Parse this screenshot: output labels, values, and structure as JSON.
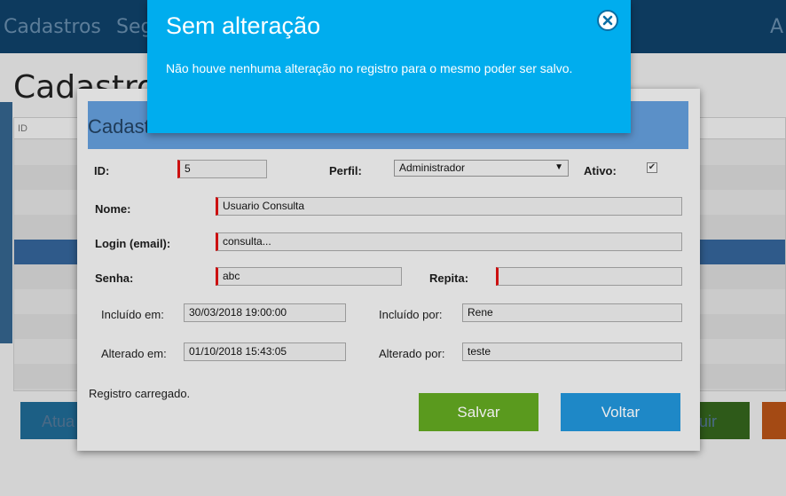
{
  "nav": {
    "items": [
      "Cadastros",
      "Seg",
      "A"
    ]
  },
  "background": {
    "page_title": "Cadastro",
    "table_header_id": "ID",
    "update_button": "Atua",
    "right_button": "uir"
  },
  "form": {
    "header_title": "Cadastro de Usuários",
    "id_label": "ID:",
    "id_value": "5",
    "perfil_label": "Perfil:",
    "perfil_selected": "Administrador",
    "ativo_label": "Ativo:",
    "ativo_checked": true,
    "nome_label": "Nome:",
    "nome_value": "Usuario Consulta",
    "login_label": "Login (email):",
    "login_value": "consulta...",
    "senha_label": "Senha:",
    "senha_value": "abc",
    "repita_label": "Repita:",
    "repita_value": "",
    "incluido_em_label": "Incluído em:",
    "incluido_em_value": "30/03/2018 19:00:00",
    "incluido_por_label": "Incluído por:",
    "incluido_por_value": "Rene",
    "alterado_em_label": "Alterado em:",
    "alterado_em_value": "01/10/2018 15:43:05",
    "alterado_por_label": "Alterado por:",
    "alterado_por_value": "teste",
    "status_text": "Registro carregado.",
    "save_label": "Salvar",
    "back_label": "Voltar"
  },
  "alert": {
    "title": "Sem alteração",
    "message": "Não houve nenhuma alteração no registro para o mesmo poder ser salvo.",
    "close_icon": "close-circle-icon"
  },
  "colors": {
    "alert_bg": "#00adee",
    "save_button": "#5a9a1e",
    "back_button": "#1e88c7",
    "required_marker": "#cc1010"
  }
}
